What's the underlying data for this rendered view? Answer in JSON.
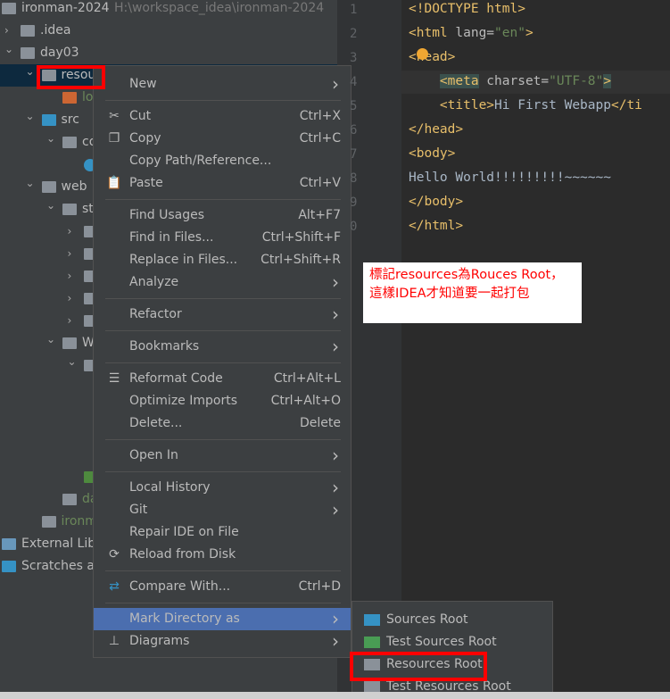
{
  "tree": [
    {
      "label": "ironman-2024",
      "extra": "H:\\workspace_idea\\ironman-2024",
      "level": 0,
      "chev": "",
      "icon": "module-folder",
      "color": "#bbbbbb"
    },
    {
      "label": ".idea",
      "level": 0,
      "chev": "right",
      "icon": "folder",
      "color": "#bbbbbb"
    },
    {
      "label": "day03",
      "level": 0,
      "chev": "down",
      "icon": "module-folder",
      "color": "#bbbbbb"
    },
    {
      "label": "resou",
      "level": 1,
      "chev": "down",
      "icon": "folder",
      "color": "#bbbbbb",
      "selected": true
    },
    {
      "label": "lo",
      "level": 2,
      "chev": "",
      "icon": "xml-file",
      "color": "#6a8759"
    },
    {
      "label": "src",
      "level": 1,
      "chev": "down",
      "icon": "source-folder",
      "color": "#bbbbbb"
    },
    {
      "label": "co",
      "level": 2,
      "chev": "down",
      "icon": "package",
      "color": "#bbbbbb"
    },
    {
      "label": "",
      "level": 3,
      "chev": "",
      "icon": "class-file",
      "color": "#bbbbbb"
    },
    {
      "label": "web",
      "level": 1,
      "chev": "down",
      "icon": "web-folder",
      "color": "#bbbbbb"
    },
    {
      "label": "st",
      "level": 2,
      "chev": "down",
      "icon": "folder",
      "color": "#bbbbbb"
    },
    {
      "label": "",
      "level": 3,
      "chev": "right",
      "icon": "folder",
      "color": "#bbbbbb"
    },
    {
      "label": "",
      "level": 3,
      "chev": "right",
      "icon": "folder",
      "color": "#bbbbbb"
    },
    {
      "label": "",
      "level": 3,
      "chev": "right",
      "icon": "folder",
      "color": "#bbbbbb"
    },
    {
      "label": "",
      "level": 3,
      "chev": "right",
      "icon": "folder",
      "color": "#bbbbbb"
    },
    {
      "label": "",
      "level": 3,
      "chev": "right",
      "icon": "folder",
      "color": "#bbbbbb"
    },
    {
      "label": "W",
      "level": 2,
      "chev": "down",
      "icon": "folder",
      "color": "#bbbbbb"
    },
    {
      "label": "",
      "level": 3,
      "chev": "down",
      "icon": "folder",
      "color": "#bbbbbb"
    },
    null,
    null,
    null,
    {
      "label": "",
      "level": 4,
      "chev": "",
      "icon": "xml-file",
      "color": "#bbbbbb"
    },
    {
      "label": "ir",
      "level": 3,
      "chev": "",
      "icon": "html-file",
      "color": "#6a8759"
    },
    {
      "label": "day0",
      "level": 2,
      "chev": "",
      "icon": "iml-file",
      "color": "#6a8759"
    },
    {
      "label": "ironman",
      "level": 1,
      "chev": "",
      "icon": "iml-file",
      "color": "#6a8759"
    },
    {
      "label": "External Lib",
      "level": 0,
      "chev": "",
      "icon": "libraries",
      "color": "#bbbbbb",
      "flush": true
    },
    {
      "label": "Scratches ar",
      "level": 0,
      "chev": "",
      "icon": "scratches",
      "color": "#bbbbbb",
      "flush": true
    }
  ],
  "editor": {
    "line_numbers": [
      "1",
      "2",
      "3",
      "4",
      "5",
      "6",
      "7",
      "8",
      "9",
      "0"
    ],
    "lines": [
      [
        [
          "tag",
          "<!DOCTYPE html>"
        ]
      ],
      [
        [
          "tag",
          "<html "
        ],
        [
          "attr",
          "lang="
        ],
        [
          "val",
          "\"en\""
        ],
        [
          "tag",
          ">"
        ]
      ],
      [
        [
          "tag",
          "<head>"
        ]
      ],
      [
        [
          "txt",
          "    "
        ],
        [
          "mt",
          "<meta"
        ],
        [
          "attr",
          " charset="
        ],
        [
          "val",
          "\"UTF-8\""
        ],
        [
          "mt",
          ">"
        ]
      ],
      [
        [
          "txt",
          "    "
        ],
        [
          "tag",
          "<title>"
        ],
        [
          "txt",
          "Hi First Webapp"
        ],
        [
          "tag",
          "</ti"
        ]
      ],
      [
        [
          "tag",
          "</head>"
        ]
      ],
      [
        [
          "tag",
          "<body>"
        ]
      ],
      [
        [
          "txt",
          "Hello World!!!!!!!!!~~~~~~"
        ]
      ],
      [
        [
          "tag",
          "</body>"
        ]
      ],
      [
        [
          "tag",
          "</html>"
        ]
      ]
    ]
  },
  "menu": [
    {
      "label": "New",
      "arrow": true
    },
    "sep",
    {
      "label": "Cut",
      "shortcut": "Ctrl+X",
      "icon": "scissors-icon",
      "glyph": "✂"
    },
    {
      "label": "Copy",
      "shortcut": "Ctrl+C",
      "icon": "copy-icon",
      "glyph": "❐"
    },
    {
      "label": "Copy Path/Reference..."
    },
    {
      "label": "Paste",
      "shortcut": "Ctrl+V",
      "icon": "paste-icon",
      "glyph": "📋"
    },
    "sep",
    {
      "label": "Find Usages",
      "shortcut": "Alt+F7"
    },
    {
      "label": "Find in Files...",
      "shortcut": "Ctrl+Shift+F"
    },
    {
      "label": "Replace in Files...",
      "shortcut": "Ctrl+Shift+R"
    },
    {
      "label": "Analyze",
      "arrow": true
    },
    "sep",
    {
      "label": "Refactor",
      "arrow": true
    },
    "sep",
    {
      "label": "Bookmarks",
      "arrow": true
    },
    "sep",
    {
      "label": "Reformat Code",
      "shortcut": "Ctrl+Alt+L",
      "icon": "reformat-icon",
      "glyph": "☰"
    },
    {
      "label": "Optimize Imports",
      "shortcut": "Ctrl+Alt+O"
    },
    {
      "label": "Delete...",
      "shortcut": "Delete"
    },
    "sep",
    {
      "label": "Open In",
      "arrow": true
    },
    "sep",
    {
      "label": "Local History",
      "arrow": true
    },
    {
      "label": "Git",
      "arrow": true
    },
    {
      "label": "Repair IDE on File"
    },
    {
      "label": "Reload from Disk",
      "icon": "reload-icon",
      "glyph": "⟳"
    },
    "sep",
    {
      "label": "Compare With...",
      "shortcut": "Ctrl+D",
      "icon": "compare-icon",
      "glyph": "⇄"
    },
    "sep",
    {
      "label": "Mark Directory as",
      "arrow": true,
      "active": true
    },
    {
      "label": "Diagrams",
      "arrow": true,
      "icon": "diagram-icon",
      "glyph": "⊥"
    }
  ],
  "submenu": [
    {
      "label": "Sources Root",
      "color": "#3592c4"
    },
    {
      "label": "Test Sources Root",
      "color": "#499c54"
    },
    {
      "label": "Resources Root",
      "color": "#8a9199"
    },
    {
      "label": "Test Resources Root",
      "color": "#8a9199"
    }
  ],
  "annotation": {
    "line1": "標記resources為Rouces Root，",
    "line2": "這樣IDEA才知道要一起打包"
  },
  "colors": {
    "highlight": "#ff0000",
    "menu_active": "#4b6eaf"
  }
}
